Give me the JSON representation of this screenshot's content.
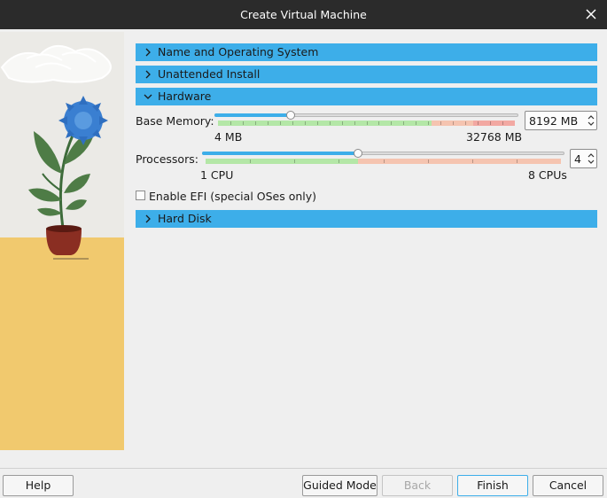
{
  "window": {
    "title": "Create Virtual Machine",
    "close_icon": "close-icon"
  },
  "sections": [
    {
      "label": "Name and Operating System",
      "expanded": false
    },
    {
      "label": "Unattended Install",
      "expanded": false
    },
    {
      "label": "Hardware",
      "expanded": true
    },
    {
      "label": "Hard Disk",
      "expanded": false
    }
  ],
  "hardware": {
    "memory": {
      "label": "Base Memory:",
      "value": "8192 MB",
      "min_label": "4 MB",
      "max_label": "32768 MB",
      "position_fraction": 0.25
    },
    "processors": {
      "label": "Processors:",
      "value": "4",
      "min_label": "1 CPU",
      "max_label": "8 CPUs",
      "position_fraction": 0.43
    },
    "efi": {
      "label": "Enable EFI (special OSes only)",
      "checked": false
    }
  },
  "buttons": {
    "help": "Help",
    "guided_mode": "Guided Mode",
    "back": "Back",
    "finish": "Finish",
    "cancel": "Cancel"
  },
  "colors": {
    "accent": "#3daee9",
    "safe_range": "#b4e7a7",
    "warn_range": "#f5c4b0",
    "danger_range": "#f2a8a2",
    "titlebar": "#2b2b2b"
  }
}
